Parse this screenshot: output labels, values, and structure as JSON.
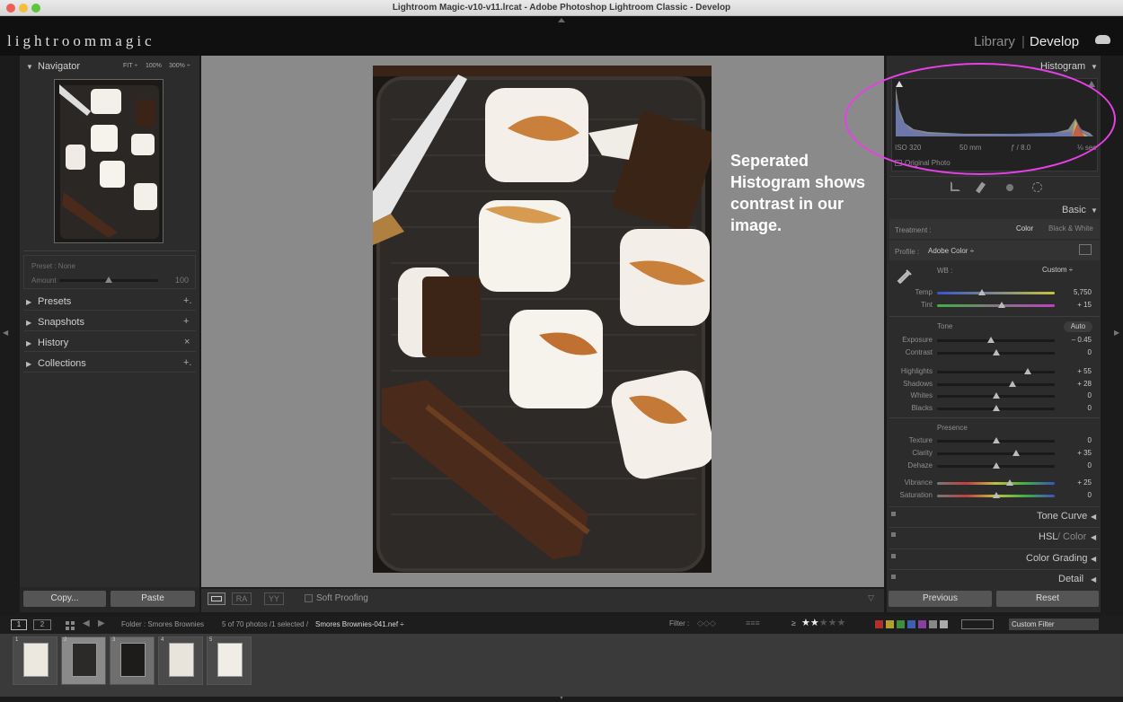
{
  "window": {
    "title": "Lightroom Magic-v10-v11.lrcat - Adobe Photoshop Lightroom Classic - Develop"
  },
  "topbar": {
    "logo": "lightroommagic",
    "modules": [
      "Library",
      "Develop"
    ],
    "module_sep": "|"
  },
  "navigator": {
    "title": "Navigator",
    "zoom_options": [
      "FIT ÷",
      "100%",
      "300% ÷"
    ]
  },
  "preset_amount": {
    "preset_label": "Preset : None",
    "amount_label": "Amount",
    "amount_value": "100"
  },
  "left_sections": [
    {
      "label": "Presets",
      "action": "+."
    },
    {
      "label": "Snapshots",
      "action": "+"
    },
    {
      "label": "History",
      "action": "×"
    },
    {
      "label": "Collections",
      "action": "+."
    }
  ],
  "left_buttons": {
    "copy": "Copy...",
    "paste": "Paste"
  },
  "annotation": "Seperated Histogram shows contrast in our image.",
  "histogram": {
    "title": "Histogram",
    "iso": "ISO 320",
    "focal": "50 mm",
    "aperture": "ƒ / 8.0",
    "shutter": "⅛ sec",
    "original_photo": "Original Photo"
  },
  "basic": {
    "title": "Basic",
    "treatment_label": "Treatment :",
    "treatment_color": "Color",
    "treatment_bw": "Black & White",
    "profile_label": "Profile :",
    "profile_value": "Adobe Color ÷",
    "wb_label": "WB :",
    "wb_value": "Custom ÷",
    "tone_label": "Tone",
    "auto_label": "Auto",
    "presence_label": "Presence",
    "sliders": [
      {
        "label": "Temp",
        "value": "5,750",
        "pos": 0.38
      },
      {
        "label": "Tint",
        "value": "+ 15",
        "pos": 0.55
      },
      {
        "label": "Exposure",
        "value": "– 0.45",
        "pos": 0.46
      },
      {
        "label": "Contrast",
        "value": "0",
        "pos": 0.5
      },
      {
        "label": "Highlights",
        "value": "+ 55",
        "pos": 0.77
      },
      {
        "label": "Shadows",
        "value": "+ 28",
        "pos": 0.64
      },
      {
        "label": "Whites",
        "value": "0",
        "pos": 0.5
      },
      {
        "label": "Blacks",
        "value": "0",
        "pos": 0.5
      },
      {
        "label": "Texture",
        "value": "0",
        "pos": 0.5
      },
      {
        "label": "Clarity",
        "value": "+ 35",
        "pos": 0.67
      },
      {
        "label": "Dehaze",
        "value": "0",
        "pos": 0.5
      },
      {
        "label": "Vibrance",
        "value": "+ 25",
        "pos": 0.62
      },
      {
        "label": "Saturation",
        "value": "0",
        "pos": 0.5
      }
    ]
  },
  "right_sections": [
    "Tone Curve",
    "HSL",
    "Color",
    "Color Grading",
    "Detail"
  ],
  "right_buttons": {
    "previous": "Previous",
    "reset": "Reset"
  },
  "toolbar": {
    "soft_proofing": "Soft Proofing"
  },
  "filmstrip": {
    "pages": [
      "1",
      "2"
    ],
    "folder": "Folder : Smores Brownies",
    "count": "5 of 70 photos /1 selected /",
    "filename": "Smores Brownies-041.nef ÷",
    "filter_label": "Filter :",
    "rating_prefix": "≥",
    "custom_filter": "Custom Filter",
    "thumb_numbers": [
      "1",
      "2",
      "3",
      "4",
      "5"
    ],
    "label_colors": [
      "#b03030",
      "#b0a030",
      "#3f8f3f",
      "#3f5fb0",
      "#8a3fa0",
      "#888888",
      "#aaaaaa"
    ]
  }
}
